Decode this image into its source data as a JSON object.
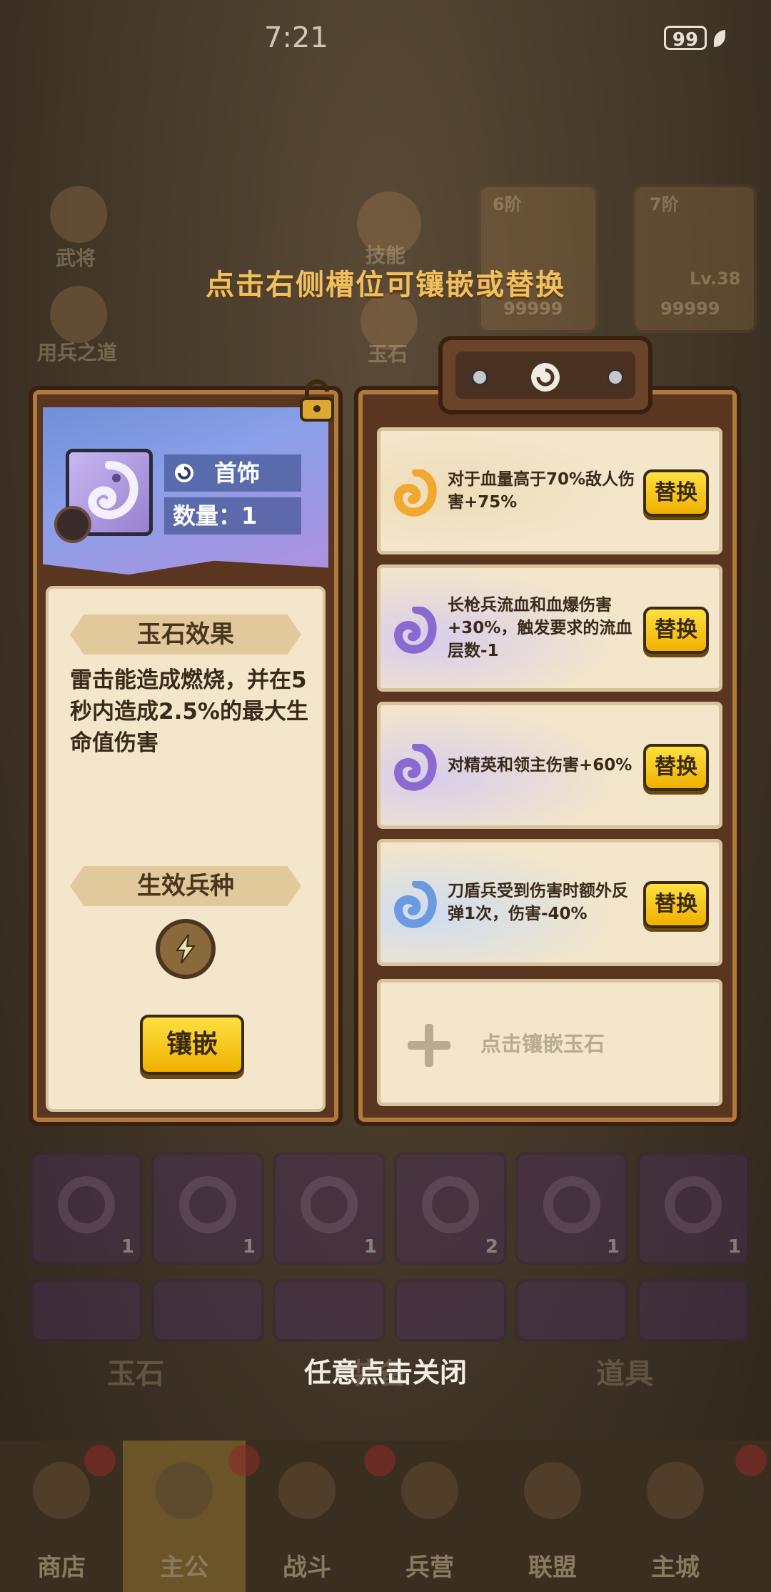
{
  "status_bar": {
    "time": "7:21",
    "battery": "99"
  },
  "background": {
    "side_labels": [
      "武将",
      "用兵之道"
    ],
    "center_labels": [
      "技能",
      "玉石"
    ],
    "card_tiers": [
      "6阶",
      "7阶"
    ],
    "card_level": "Lv.38",
    "card_values": [
      "99999",
      "99999"
    ],
    "gem_counts": [
      "1",
      "1",
      "1",
      "2",
      "1",
      "1"
    ],
    "tabs": [
      "玉石",
      "装备",
      "道具"
    ]
  },
  "hint_top": "点击右侧槽位可镶嵌或替换",
  "item": {
    "type_label": "首饰",
    "count_label": "数量：1",
    "effect_title": "玉石效果",
    "effect_text": "雷击能造成燃烧，并在5秒内造成2.5%的最大生命值伤害",
    "unit_title": "生效兵种",
    "inlay_button": "镶嵌"
  },
  "slots": [
    {
      "desc": "对于血量高于70%敌人伤害+75%",
      "button": "替换",
      "gem_color": "#f0a830",
      "glow": "#efdcb8"
    },
    {
      "desc": "长枪兵流血和血爆伤害+30%，触发要求的流血层数-1",
      "button": "替换",
      "gem_color": "#8a6ad0",
      "glow": "#d8cdec"
    },
    {
      "desc": "对精英和领主伤害+60%",
      "button": "替换",
      "gem_color": "#8a6ad0",
      "glow": "#d8cdec"
    },
    {
      "desc": "刀盾兵受到伤害时额外反弹1次，伤害-40%",
      "button": "替换",
      "gem_color": "#6a9ae0",
      "glow": "#cfdcef"
    }
  ],
  "empty_slot_text": "点击镶嵌玉石",
  "close_hint": "任意点击关闭",
  "bottom_nav": [
    "商店",
    "主公",
    "战斗",
    "兵营",
    "联盟",
    "主城"
  ]
}
